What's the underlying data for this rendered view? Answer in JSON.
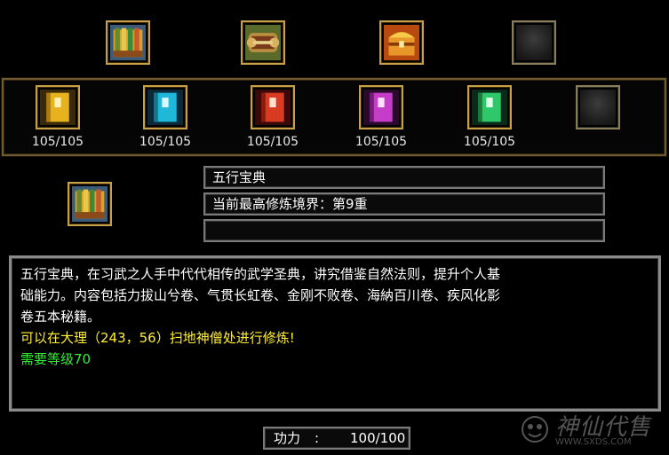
{
  "top_slots": [
    {
      "icon": "book-stack-icon",
      "filled": true
    },
    {
      "icon": "scroll-bundle-icon",
      "filled": true
    },
    {
      "icon": "treasure-chest-icon",
      "filled": true
    },
    {
      "icon": "empty-slot-icon",
      "filled": false
    }
  ],
  "books": [
    {
      "icon": "yellow-book-icon",
      "color": "#e6b21e",
      "count": "105/105"
    },
    {
      "icon": "cyan-book-icon",
      "color": "#20b8d8",
      "count": "105/105"
    },
    {
      "icon": "red-book-icon",
      "color": "#d83a22",
      "count": "105/105"
    },
    {
      "icon": "magenta-book-icon",
      "color": "#c43cc8",
      "count": "105/105"
    },
    {
      "icon": "green-book-icon",
      "color": "#2ec86a",
      "count": "105/105"
    }
  ],
  "selected": {
    "icon": "five-elements-book-icon",
    "name": "五行宝典",
    "realm": "当前最高修炼境界：第9重",
    "extra": ""
  },
  "description": {
    "line1": "五行宝典，在习武之人手中代代相传的武学圣典，讲究借鉴自然法则，提升个人基",
    "line2": "础能力。内容包括力拔山兮卷、气贯长虹卷、金刚不败卷、海納百川卷、疾风化影",
    "line3": "卷五本秘籍。",
    "location": "可以在大理（243，56）扫地神僧处进行修炼!",
    "level": "需要等级70"
  },
  "power": {
    "label": "功力",
    "separator": ":",
    "value": "100/100"
  },
  "watermark": {
    "text": "神仙代售",
    "url": "WWW.SXDS.COM"
  },
  "colors": {
    "gold_border": "#c8a048",
    "white_text": "#ffffff",
    "yellow_text": "#ffee33",
    "green_text": "#33ee33"
  }
}
